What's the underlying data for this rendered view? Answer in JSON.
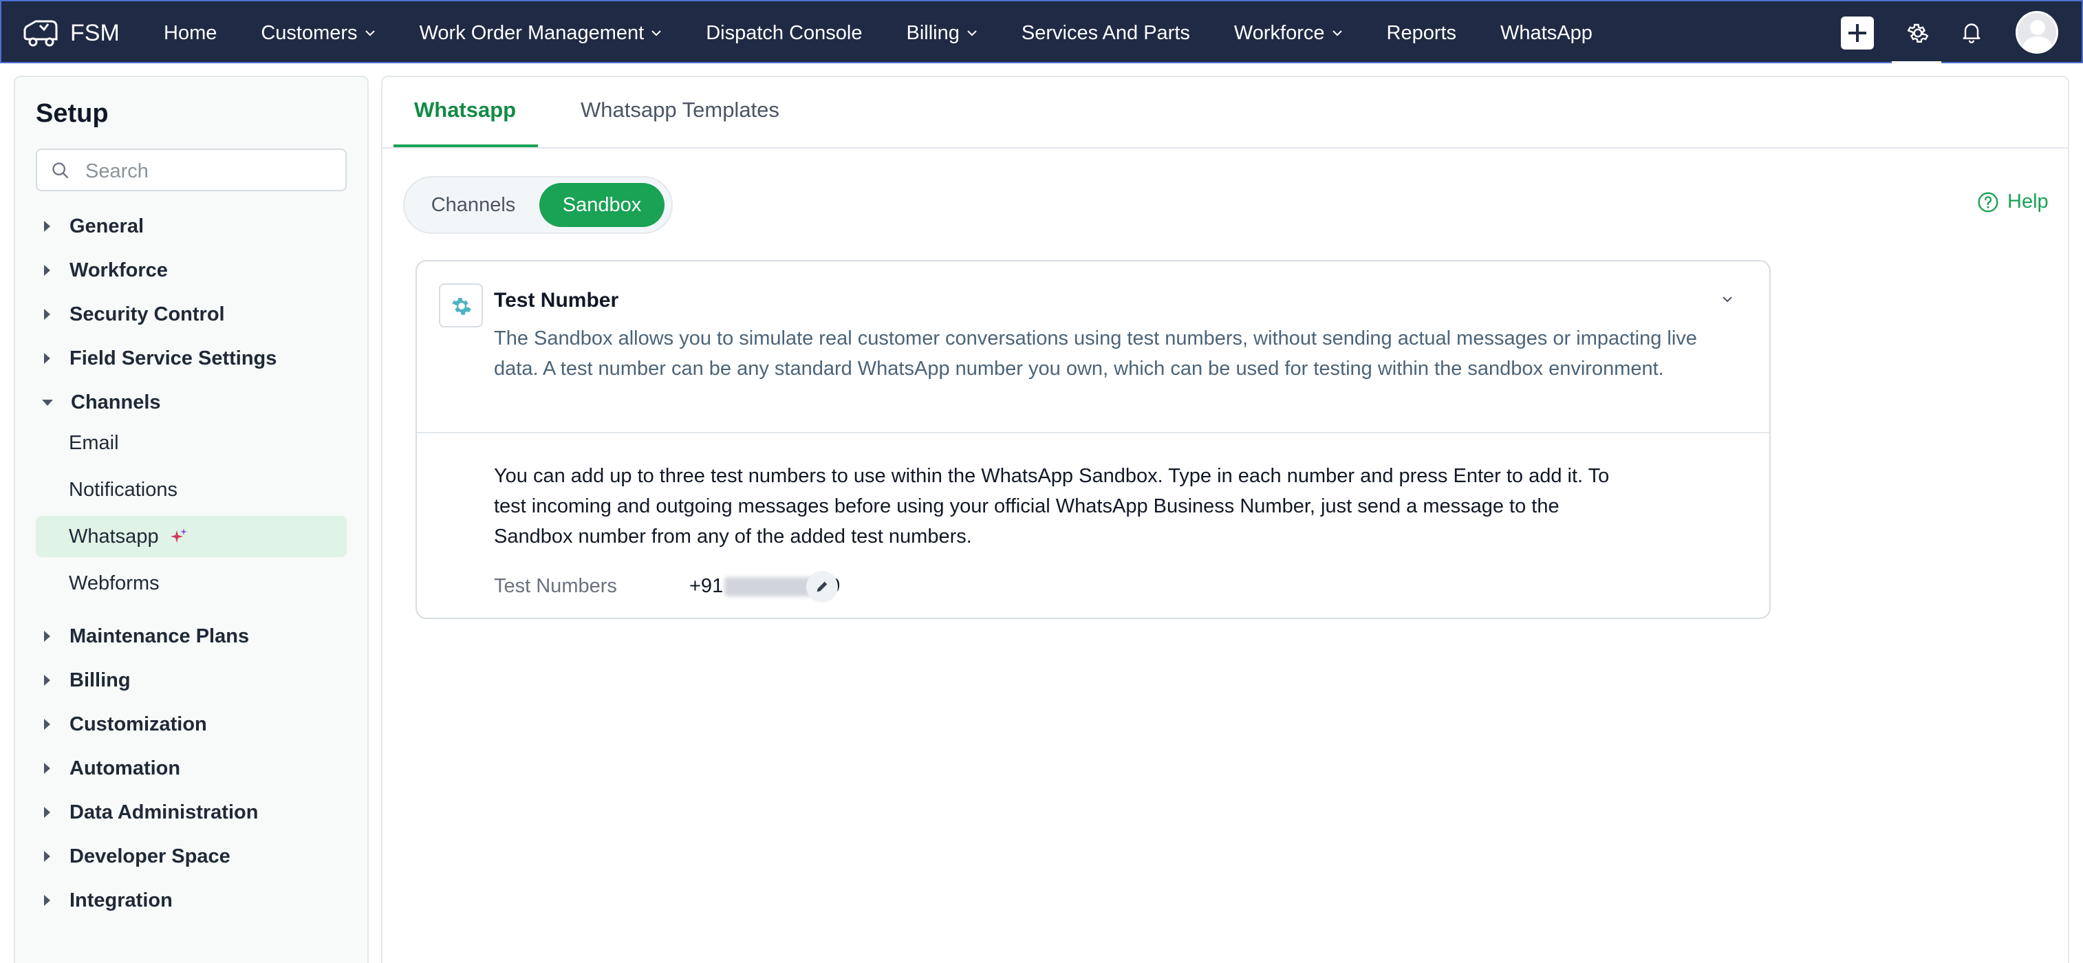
{
  "brand": {
    "name": "FSM"
  },
  "nav": {
    "items": [
      {
        "label": "Home",
        "dropdown": false
      },
      {
        "label": "Customers",
        "dropdown": true
      },
      {
        "label": "Work Order Management",
        "dropdown": true
      },
      {
        "label": "Dispatch Console",
        "dropdown": false
      },
      {
        "label": "Billing",
        "dropdown": true
      },
      {
        "label": "Services And Parts",
        "dropdown": false
      },
      {
        "label": "Workforce",
        "dropdown": true
      },
      {
        "label": "Reports",
        "dropdown": false
      },
      {
        "label": "WhatsApp",
        "dropdown": false
      }
    ],
    "icons": [
      "plus-icon",
      "gear-icon",
      "bell-icon",
      "avatar"
    ]
  },
  "sidebar": {
    "title": "Setup",
    "search_placeholder": "Search",
    "items": [
      {
        "label": "General",
        "expanded": false
      },
      {
        "label": "Workforce",
        "expanded": false
      },
      {
        "label": "Security Control",
        "expanded": false
      },
      {
        "label": "Field Service Settings",
        "expanded": false
      },
      {
        "label": "Channels",
        "expanded": true
      },
      {
        "label": "Maintenance Plans",
        "expanded": false
      },
      {
        "label": "Billing",
        "expanded": false
      },
      {
        "label": "Customization",
        "expanded": false
      },
      {
        "label": "Automation",
        "expanded": false
      },
      {
        "label": "Data Administration",
        "expanded": false
      },
      {
        "label": "Developer Space",
        "expanded": false
      },
      {
        "label": "Integration",
        "expanded": false
      }
    ],
    "channels_sub": [
      {
        "label": "Email",
        "active": false
      },
      {
        "label": "Notifications",
        "active": false
      },
      {
        "label": "Whatsapp",
        "active": true
      },
      {
        "label": "Webforms",
        "active": false
      }
    ]
  },
  "main": {
    "tabs": [
      {
        "label": "Whatsapp",
        "active": true
      },
      {
        "label": "Whatsapp Templates",
        "active": false
      }
    ],
    "segment": {
      "channels": "Channels",
      "sandbox": "Sandbox",
      "selected": "Sandbox"
    },
    "help_label": "Help",
    "card": {
      "title": "Test Number",
      "description": "The Sandbox allows you to simulate real customer conversations using test numbers, without sending actual messages or impacting live data. A test number can be any standard WhatsApp number you own, which can be used for testing within the sandbox environment.",
      "info": "You can add up to three test numbers to use within the WhatsApp Sandbox. Type in each number and press Enter to add it. To test incoming and outgoing messages before using your official WhatsApp Business Number, just send a message to the Sandbox number from any of the added test numbers.",
      "test_numbers_label": "Test Numbers",
      "test_number_prefix": "+91",
      "test_number_suffix": "9"
    }
  },
  "colors": {
    "nav_bg": "#1f2a44",
    "accent_green": "#1aa255",
    "active_tab_text": "#138a45",
    "sidebar_active_bg": "#dff3e6"
  }
}
